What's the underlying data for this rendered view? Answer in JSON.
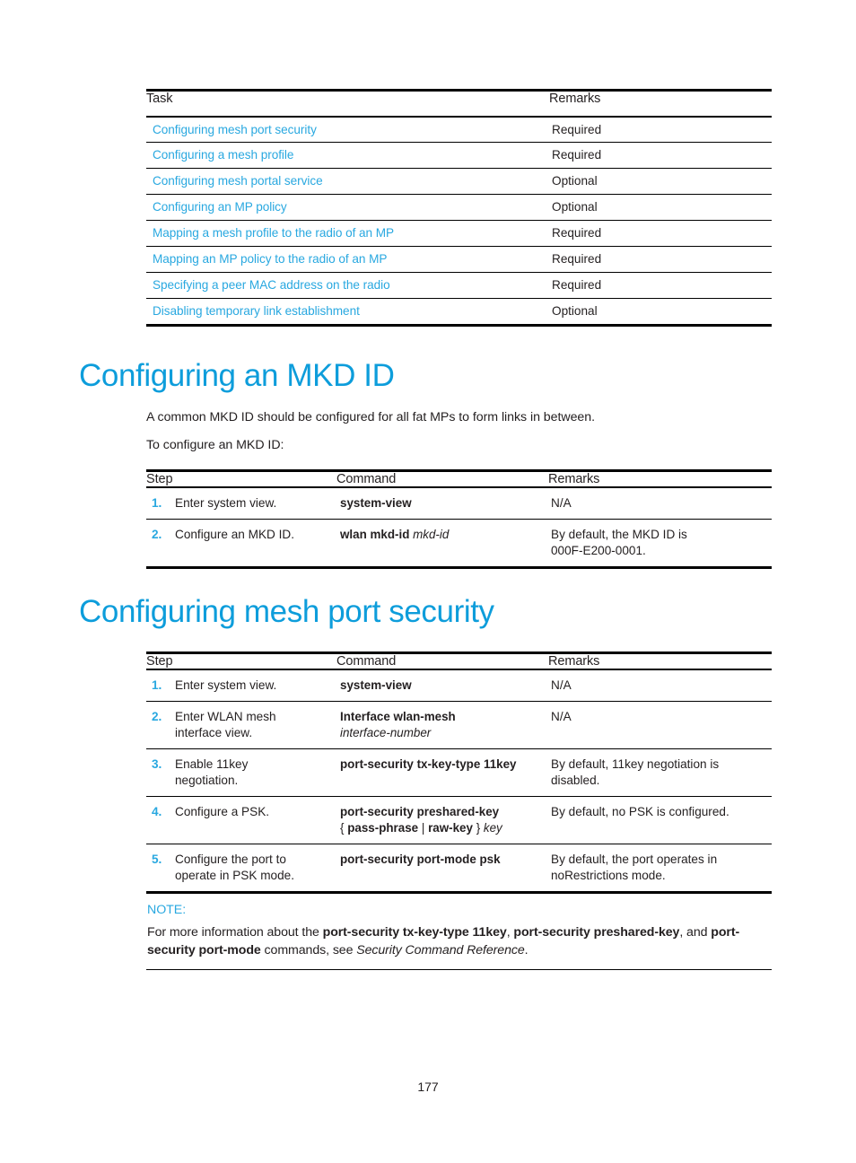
{
  "colors": {
    "heading_blue": "#0d9ddb",
    "link_blue": "#29a8e0",
    "body_text": "#231f20",
    "rule": "#000000"
  },
  "task_table": {
    "headers": {
      "task": "Task",
      "remarks": "Remarks"
    },
    "rows": [
      {
        "task": "Configuring mesh port security",
        "remarks": "Required"
      },
      {
        "task": "Configuring a mesh profile",
        "remarks": "Required"
      },
      {
        "task": "Configuring mesh portal service",
        "remarks": "Optional"
      },
      {
        "task": "Configuring an MP policy",
        "remarks": "Optional"
      },
      {
        "task": "Mapping a mesh profile to the radio of an MP",
        "remarks": "Required"
      },
      {
        "task": "Mapping an MP policy to the radio of an MP",
        "remarks": "Required"
      },
      {
        "task": "Specifying a peer MAC address on the radio",
        "remarks": "Required"
      },
      {
        "task": "Disabling temporary link establishment",
        "remarks": "Optional"
      }
    ]
  },
  "mkd_section": {
    "heading": "Configuring an MKD ID",
    "paragraph_1": "A common MKD ID should be configured for all fat MPs to form links in between.",
    "paragraph_2": "To configure an MKD ID:",
    "table": {
      "headers": {
        "step": "Step",
        "command": "Command",
        "remarks": "Remarks"
      },
      "rows": [
        {
          "num": "1.",
          "step": "Enter system view.",
          "command_bold": "system-view",
          "command_italic": "",
          "remarks": "N/A"
        },
        {
          "num": "2.",
          "step": "Configure an MKD ID.",
          "command_bold": "wlan mkd-id",
          "command_italic": "mkd-id",
          "remarks_line_1": "By default, the MKD ID is",
          "remarks_line_2": "000F-E200-0001."
        }
      ]
    }
  },
  "mesh_section": {
    "heading": "Configuring mesh port security",
    "table": {
      "headers": {
        "step": "Step",
        "command": "Command",
        "remarks": "Remarks"
      },
      "rows": [
        {
          "num": "1.",
          "step": "Enter system view.",
          "command_bold": "system-view",
          "command_italic": "",
          "remarks": "N/A"
        },
        {
          "num": "2.",
          "step_line_1": "Enter WLAN mesh",
          "step_line_2": "interface view.",
          "command_bold": "Interface wlan-mesh",
          "command_italic": "interface-number",
          "remarks": "N/A"
        },
        {
          "num": "3.",
          "step_line_1": "Enable 11key",
          "step_line_2": "negotiation.",
          "command_bold": "port-security tx-key-type 11key",
          "remarks_line_1": "By default, 11key negotiation is",
          "remarks_line_2": "disabled."
        },
        {
          "num": "4.",
          "step": "Configure a PSK.",
          "command_bold_1": "port-security preshared-key",
          "command_brace_open": "{",
          "command_bold_2": "pass-phrase",
          "command_pipe": "|",
          "command_bold_3": "raw-key",
          "command_brace_close": "}",
          "command_italic": "key",
          "remarks": "By default, no PSK is configured."
        },
        {
          "num": "5.",
          "step_line_1": "Configure the port to",
          "step_line_2": "operate in PSK mode.",
          "command_bold": "port-security port-mode psk",
          "remarks_line_1": "By default, the port operates in",
          "remarks_line_2": "noRestrictions mode."
        }
      ]
    }
  },
  "note": {
    "label": "NOTE:",
    "text_1": "For more information about the ",
    "cmd_1": "port-security tx-key-type 11key",
    "text_2": ", ",
    "cmd_2": "port-security preshared-key",
    "text_3": ", and ",
    "cmd_3": "port-security port-mode",
    "text_4": " commands, see ",
    "reference": "Security Command Reference",
    "text_5": "."
  },
  "footer": {
    "page_number": "177"
  }
}
